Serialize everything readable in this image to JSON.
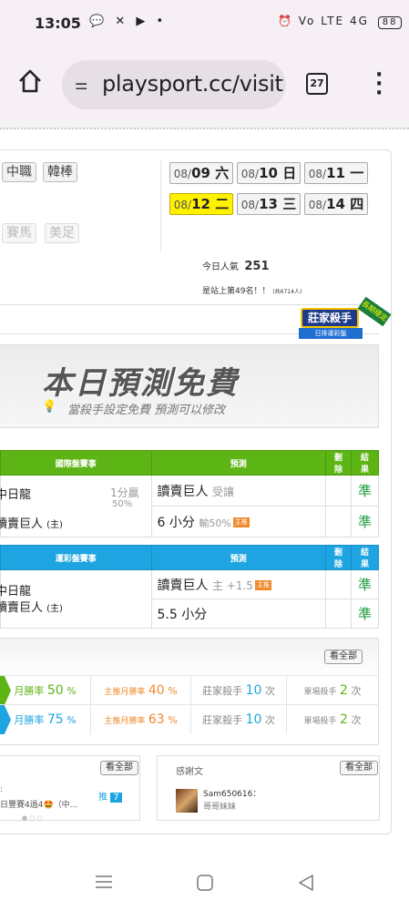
{
  "status_bar": {
    "time": "13:05",
    "notification_icons": "💬 ✕ ▶ •",
    "right_icons": "⏰ Vo LTE 4G",
    "battery": "88"
  },
  "browser": {
    "url": "playsport.cc/visit",
    "tab_count": "27"
  },
  "categories": {
    "row1": [
      "中職",
      "韓棒"
    ],
    "row2": [
      "賽馬",
      "美足"
    ]
  },
  "dates": [
    {
      "prefix": "08/",
      "day": "09 六",
      "active": false
    },
    {
      "prefix": "08/",
      "day": "10 日",
      "active": false
    },
    {
      "prefix": "08/",
      "day": "11 一",
      "active": false
    },
    {
      "prefix": "08/",
      "day": "12 二",
      "active": true
    },
    {
      "prefix": "08/",
      "day": "13 三",
      "active": false
    },
    {
      "prefix": "08/",
      "day": "14 四",
      "active": false
    }
  ],
  "popularity": {
    "label": "今日人氣",
    "value": "251",
    "rank": "是站上第49名！！",
    "rank_note": "(共6714人)"
  },
  "badge": {
    "main": "莊家殺手",
    "sub": "日排運彩盤",
    "tag": "長期穩定"
  },
  "free_banner": {
    "title": "本日預測免費",
    "subtitle": "當殺手設定免費 預測可以修改"
  },
  "intl_table": {
    "headers": [
      "國際盤賽事",
      "預測",
      "刪除",
      "結果"
    ],
    "team1": "中日龍",
    "team2": "讀賣巨人",
    "home_mark": "(主)",
    "line1": "1分贏",
    "line2": "50%",
    "pred1_team": "讀賣巨人",
    "pred1_note": "受讓",
    "pred2_main": "6 小分",
    "pred2_note": "輸50%",
    "tag": "主推",
    "result1": "準",
    "result2": "準"
  },
  "lottery_table": {
    "headers": [
      "運彩盤賽事",
      "預測",
      "刪除",
      "結果"
    ],
    "team1": "中日龍",
    "team2": "讀賣巨人",
    "home_mark": "(主)",
    "pred1_team": "讀賣巨人",
    "pred1_note": "主 +1.5",
    "pred2_main": "5.5 小分",
    "tag": "主推",
    "result1": "準",
    "result2": "準"
  },
  "stats": {
    "view_all": "看全部",
    "rows": [
      {
        "win_label": "月勝率",
        "win": "50",
        "main_label": "主推月勝率",
        "main": "40",
        "banker_label": "莊家殺手",
        "banker": "10",
        "single_label": "單場殺手",
        "single": "2",
        "unit": "次",
        "pct": "%"
      },
      {
        "win_label": "月勝率",
        "win": "75",
        "main_label": "主推月勝率",
        "main": "63",
        "banker_label": "莊家殺手",
        "banker": "10",
        "single_label": "單場殺手",
        "single": "2",
        "unit": "次",
        "pct": "%"
      }
    ]
  },
  "left_card": {
    "view_all": "看全部",
    "line1": ":",
    "line2": "日豐賽4過4🤩（中...",
    "push_label": "推",
    "push_count": "7"
  },
  "thanks_card": {
    "title": "感謝文",
    "view_all": "看全部",
    "user": "Sam650616：",
    "message": "哥哥妹妹"
  },
  "colors": {
    "green": "#5db515",
    "blue": "#1ea4e0",
    "active_date": "#fff200",
    "win_green": "#1a9a3a"
  }
}
